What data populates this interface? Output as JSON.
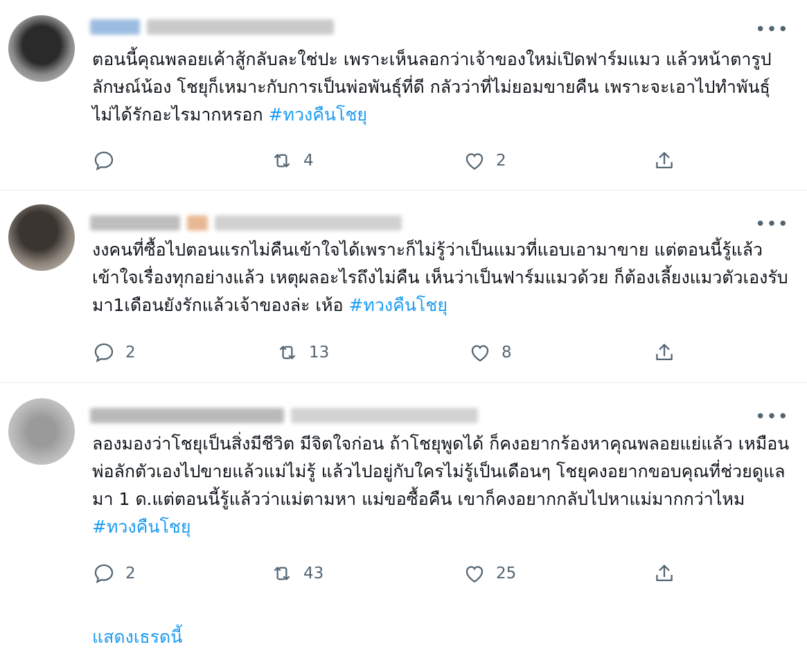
{
  "tweets": [
    {
      "text_main": "ตอนนี้คุณพลอยเค้าสู้กลับละใช่ปะ เพราะเห็นลอกว่าเจ้าของใหม่เปิดฟาร์มแมว แล้วหน้าตารูปลักษณ์น้อง โชยุก็เหมาะกับการเป็นพ่อพันธุ์ที่ดี กลัวว่าที่ไม่ยอมขายคืน เพราะจะเอาไปทำพันธุ์ ไม่ได้รักอะไรมากหรอก ",
      "hashtag": "#ทวงคืนโชยุ",
      "reply_count": "",
      "retweet_count": "4",
      "like_count": "2"
    },
    {
      "text_main": "งงคนที่ซื้อไปตอนแรกไม่คืนเข้าใจได้เพราะก็ไม่รู้ว่าเป็นแมวที่แอบเอามาขาย แต่ตอนนี้รู้แล้ว เข้าใจเรื่องทุกอย่างแล้ว เหตุผลอะไรถึงไม่คืน เห็นว่าเป็นฟาร์มแมวด้วย ก็ต้องเลี้ยงแมวตัวเองรับมา1เดือนยังรักแล้วเจ้าของล่ะ เห้อ ",
      "hashtag": "#ทวงคืนโชยุ",
      "reply_count": "2",
      "retweet_count": "13",
      "like_count": "8"
    },
    {
      "text_main": "ลองมองว่าโชยุเป็นสิ่งมีชีวิต มีจิตใจก่อน ถ้าโชยุพูดได้ ก็คงอยากร้องหาคุณพลอยแย่แล้ว เหมือนพ่อลักตัวเองไปขายแล้วแม่ไม่รู้ แล้วไปอยู่กับใครไม่รู้เป็นเดือนๆ โชยุคงอยากขอบคุณที่ช่วยดูแลมา 1 ด.แต่ตอนนี้รู้แล้วว่าแม่ตามหา แม่ขอซื้อคืน เขาก็คงอยากกลับไปหาแม่มากกว่าไหม ",
      "hashtag": "#ทวงคืนโชยุ",
      "reply_count": "2",
      "retweet_count": "43",
      "like_count": "25"
    }
  ],
  "more_label": "•••",
  "show_thread": "แสดงเธรดนี้",
  "icons": [
    "reply-icon",
    "retweet-icon",
    "like-icon",
    "share-icon",
    "more-icon"
  ],
  "colors": {
    "accent": "#1d9bf0",
    "secondary_text": "#536471",
    "divider": "#e6e9eb"
  }
}
